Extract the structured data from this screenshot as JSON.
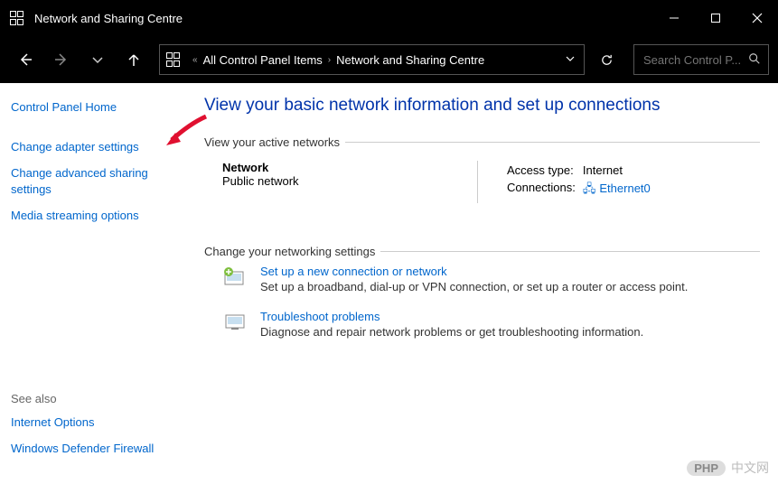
{
  "titlebar": {
    "title": "Network and Sharing Centre"
  },
  "breadcrumb": {
    "item1": "All Control Panel Items",
    "item2": "Network and Sharing Centre"
  },
  "search": {
    "placeholder": "Search Control P..."
  },
  "sidebar": {
    "home": "Control Panel Home",
    "adapter": "Change adapter settings",
    "advanced": "Change advanced sharing settings",
    "media": "Media streaming options",
    "seealso_label": "See also",
    "internet_options": "Internet Options",
    "firewall": "Windows Defender Firewall"
  },
  "main": {
    "heading": "View your basic network information and set up connections",
    "active_networks_label": "View your active networks",
    "network_name": "Network",
    "network_type": "Public network",
    "access_type_label": "Access type:",
    "access_type_value": "Internet",
    "connections_label": "Connections:",
    "connection_value": "Ethernet0",
    "change_settings_label": "Change your networking settings",
    "opt1_link": "Set up a new connection or network",
    "opt1_desc": "Set up a broadband, dial-up or VPN connection, or set up a router or access point.",
    "opt2_link": "Troubleshoot problems",
    "opt2_desc": "Diagnose and repair network problems or get troubleshooting information."
  },
  "watermark": {
    "badge": "PHP",
    "text": "中文网"
  }
}
